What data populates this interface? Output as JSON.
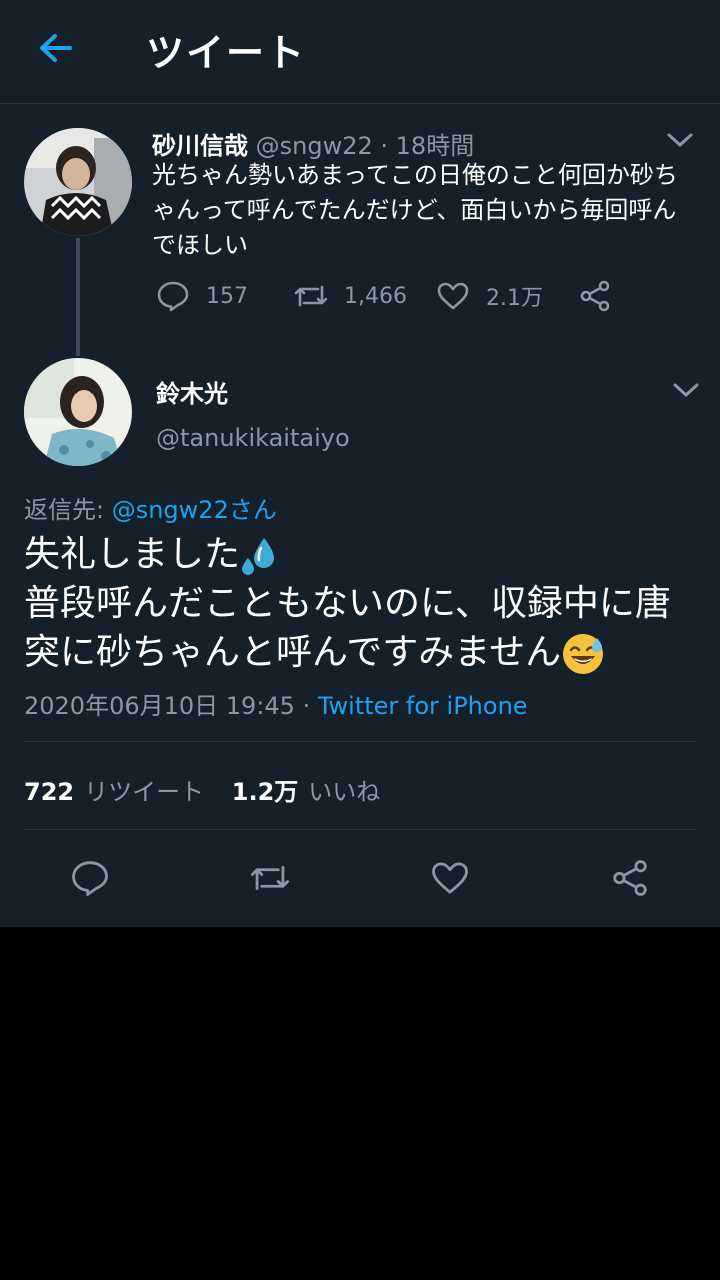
{
  "header": {
    "title": "ツイート"
  },
  "parent_tweet": {
    "name": "砂川信哉",
    "handle": "@sngw22",
    "time": "· 18時間",
    "text": "光ちゃん勢いあまってこの日俺のこと何回か砂ちゃんって呼んでたんだけど、面白いから毎回呼んでほしい",
    "replies": "157",
    "retweets": "1,466",
    "likes": "2.1万"
  },
  "main_tweet": {
    "name": "鈴木光",
    "handle": "@tanukikaitaiyo",
    "reply_label": "返信先: ",
    "reply_target": "@sngw22さん",
    "line1": "失礼しました",
    "line2": "普段呼んだこともないのに、収録中に唐突に砂ちゃんと呼んですみません",
    "timestamp": "2020年06月10日 19:45 · ",
    "source": "Twitter for iPhone",
    "retweet_count": "722",
    "retweet_label": "リツイート",
    "like_count": "1.2万",
    "like_label": "いいね"
  },
  "colors": {
    "background": "#15202b",
    "accent": "#1da1f2",
    "muted": "#8899a6",
    "divider": "#2a3643"
  },
  "icons": [
    "back-arrow-icon",
    "caret-down-icon",
    "reply-icon",
    "retweet-icon",
    "like-icon",
    "share-icon",
    "sweat-droplets-emoji",
    "grinning-sweat-emoji"
  ]
}
